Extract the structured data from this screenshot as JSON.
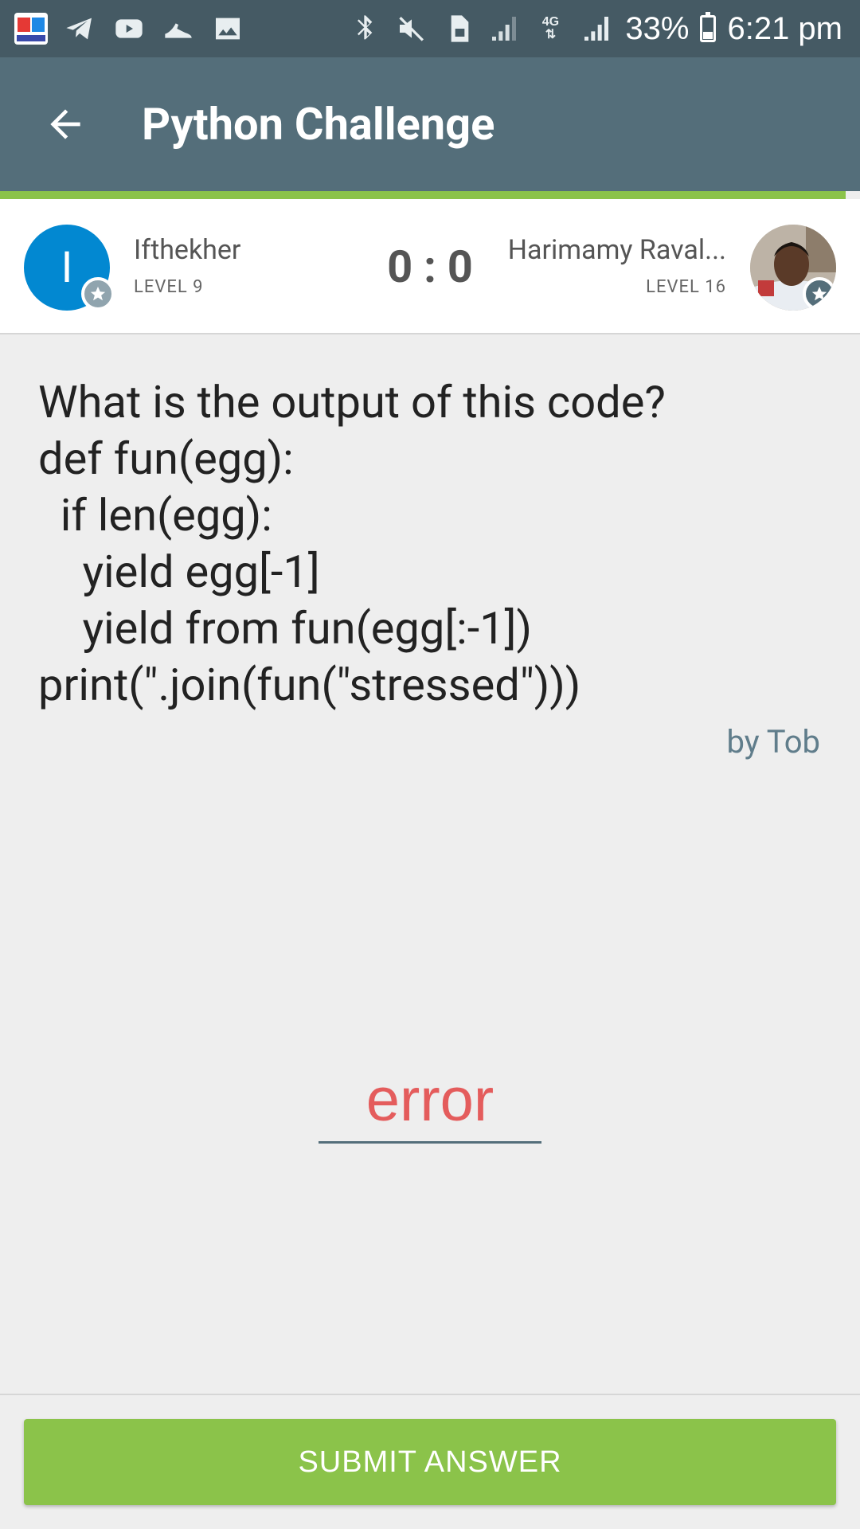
{
  "status_bar": {
    "battery": "33%",
    "time": "6:21 pm",
    "network": "4G",
    "icons": [
      "app-icon",
      "telegram-icon",
      "youtube-icon",
      "shoe-icon",
      "image-icon",
      "bluetooth-icon",
      "mute-icon",
      "sim-icon",
      "signal-icon",
      "data-icon",
      "signal-icon",
      "battery-icon"
    ]
  },
  "app_bar": {
    "title": "Python Challenge",
    "back_icon": "arrow-left-icon"
  },
  "players": {
    "left": {
      "initial": "I",
      "name": "Ifthekher",
      "level": "LEVEL 9"
    },
    "right": {
      "name": "Harimamy Raval...",
      "level": "LEVEL 16"
    },
    "score": "0 : 0"
  },
  "question": {
    "text": "What is the output of this code?\ndef fun(egg):\n  if len(egg):\n    yield egg[-1]\n    yield from fun(egg[:-1])\nprint(\".join(fun(\"stressed\")))",
    "author": "by Tob"
  },
  "answer": {
    "value": "error"
  },
  "submit": {
    "label": "SUBMIT ANSWER"
  },
  "colors": {
    "status_bar": "#455a64",
    "app_bar": "#546e7a",
    "accent_green": "#8bc34a",
    "left_avatar": "#0288d1",
    "answer_text": "#e45c5c"
  }
}
